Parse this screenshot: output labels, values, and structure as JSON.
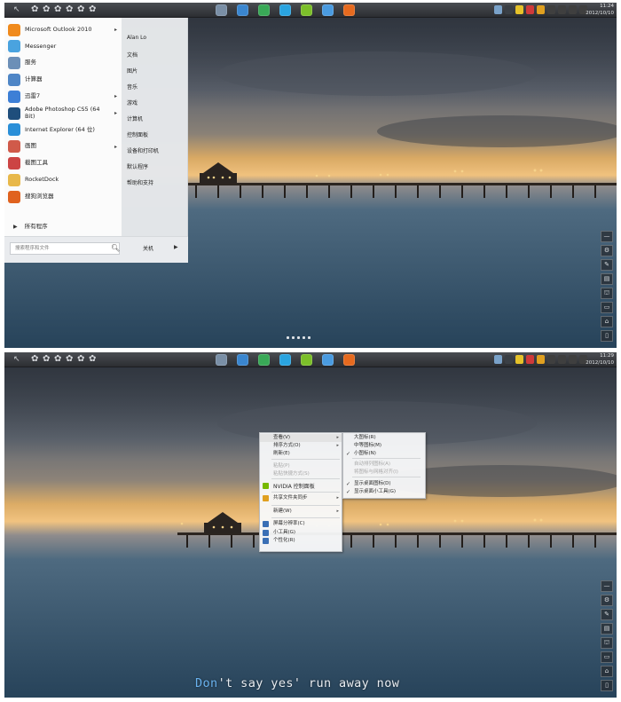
{
  "screen1": {
    "start_menu": {
      "programs": [
        {
          "label": "Microsoft Outlook 2010",
          "icon": "outlook-icon",
          "color": "#f08a1c",
          "submenu": true
        },
        {
          "label": "Messenger",
          "icon": "messenger-icon",
          "color": "#4aa3df",
          "submenu": false
        },
        {
          "label": "服务",
          "icon": "services-icon",
          "color": "#6c8fb7",
          "submenu": false
        },
        {
          "label": "计算器",
          "icon": "calculator-icon",
          "color": "#4f86c6",
          "submenu": false
        },
        {
          "label": "迅雷7",
          "icon": "thunder-icon",
          "color": "#3d7fd6",
          "submenu": true
        },
        {
          "label": "Adobe Photoshop CS5 (64 Bit)",
          "icon": "photoshop-icon",
          "color": "#1f4e7c",
          "submenu": true
        },
        {
          "label": "Internet Explorer (64 位)",
          "icon": "internet-explorer-icon",
          "color": "#2a8fd8",
          "submenu": false
        },
        {
          "label": "画图",
          "icon": "paint-icon",
          "color": "#d05a4a",
          "submenu": true
        },
        {
          "label": "截图工具",
          "icon": "snipping-tool-icon",
          "color": "#c44",
          "submenu": false
        },
        {
          "label": "RocketDock",
          "icon": "rocketdock-icon",
          "color": "#e8b84a",
          "submenu": false
        },
        {
          "label": "搜狗浏览器",
          "icon": "sogou-browser-icon",
          "color": "#e0621f",
          "submenu": false
        }
      ],
      "all_programs": "所有程序",
      "right_items": [
        "Alan Lo",
        "文档",
        "图片",
        "音乐",
        "游戏",
        "计算机",
        "控制面板",
        "设备和打印机",
        "默认程序",
        "帮助和支持"
      ],
      "search_placeholder": "搜索程序和文件",
      "shutdown_label": "关机"
    }
  },
  "screen2": {
    "context_menu": {
      "items": [
        {
          "label": "查看(V)",
          "highlight": true,
          "submenu": true
        },
        {
          "label": "排序方式(O)",
          "submenu": true
        },
        {
          "label": "刷新(E)"
        },
        {
          "label": "粘贴(P)",
          "disabled": true
        },
        {
          "label": "粘贴快捷方式(S)",
          "disabled": true
        },
        {
          "label": "NVIDIA 控制面板",
          "icon": "nvidia-icon"
        },
        {
          "label": "共享文件夹同步",
          "icon": "sync-icon",
          "submenu": true
        },
        {
          "label": "新建(W)",
          "submenu": true
        },
        {
          "label": "屏幕分辨率(C)",
          "icon": "display-icon"
        },
        {
          "label": "小工具(G)",
          "icon": "gadgets-icon"
        },
        {
          "label": "个性化(R)",
          "icon": "personalize-icon"
        }
      ]
    },
    "view_submenu": {
      "items": [
        {
          "label": "大图标(R)"
        },
        {
          "label": "中等图标(M)"
        },
        {
          "label": "小图标(N)",
          "checked": true
        },
        {
          "label": "自动排列图标(A)",
          "disabled": true
        },
        {
          "label": "将图标与网格对齐(I)",
          "disabled": true
        },
        {
          "label": "显示桌面图标(D)",
          "checked": true
        },
        {
          "label": "显示桌面小工具(G)",
          "checked": true
        }
      ]
    },
    "lyric_highlight": "Don",
    "lyric_rest": "'t say yes' run away now"
  },
  "taskbar": {
    "clock_1": {
      "time": "11:24",
      "date": "2012/10/10"
    },
    "clock_2": {
      "time": "11:29",
      "date": "2012/10/10"
    },
    "app_icons": [
      {
        "name": "explorer-icon",
        "color": "#7a8fa6"
      },
      {
        "name": "ie-icon",
        "color": "#3a86cf"
      },
      {
        "name": "chrome-icon",
        "color": "#39a957"
      },
      {
        "name": "skype-icon",
        "color": "#2aa4e0"
      },
      {
        "name": "green-app-icon",
        "color": "#7cbf2a"
      },
      {
        "name": "messenger-icon",
        "color": "#4a9be0"
      },
      {
        "name": "firefox-icon",
        "color": "#e66a1f"
      }
    ],
    "tray_colors": [
      "#7aa2c9",
      "#3a3f45",
      "#e6c22a",
      "#cf3a3a",
      "#e0a020",
      "#3f3f3f",
      "#3f3f3f",
      "#3f3f3f",
      "#3f3f3f"
    ]
  },
  "dock_icons": [
    "minimize-icon",
    "settings-icon",
    "brush-icon",
    "folder-icon",
    "trash-up-icon",
    "window-icon",
    "home-icon",
    "recycle-bin-icon"
  ]
}
